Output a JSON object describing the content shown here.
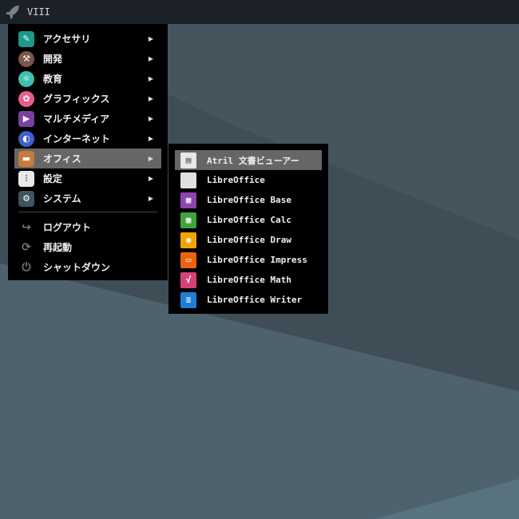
{
  "topbar": {
    "workspace": "VIII",
    "icon": "rocket-icon"
  },
  "main_menu": {
    "items": [
      {
        "label": "アクセサリ",
        "icon": "accessories-icon",
        "color": "#1a9a8a",
        "submenu": true
      },
      {
        "label": "開発",
        "icon": "development-icon",
        "color": "#7a5548",
        "submenu": true
      },
      {
        "label": "教育",
        "icon": "education-icon",
        "color": "#3cc0b0",
        "submenu": true
      },
      {
        "label": "グラフィックス",
        "icon": "graphics-icon",
        "color": "#e85d8a",
        "submenu": true
      },
      {
        "label": "マルチメディア",
        "icon": "multimedia-icon",
        "color": "#7b3fa0",
        "submenu": true
      },
      {
        "label": "インターネット",
        "icon": "internet-icon",
        "color": "#3d5fd0",
        "submenu": true
      },
      {
        "label": "オフィス",
        "icon": "office-icon",
        "color": "#c77a3c",
        "submenu": true,
        "selected": true
      },
      {
        "label": "設定",
        "icon": "settings-icon",
        "color": "#e8e8e8",
        "submenu": true
      },
      {
        "label": "システム",
        "icon": "system-icon",
        "color": "#3c5560",
        "submenu": true
      }
    ],
    "actions": [
      {
        "label": "ログアウト",
        "icon": "logout-icon"
      },
      {
        "label": "再起動",
        "icon": "restart-icon"
      },
      {
        "label": "シャットダウン",
        "icon": "shutdown-icon"
      }
    ]
  },
  "office_menu": {
    "items": [
      {
        "label": "Atril 文書ビューアー",
        "icon": "atril-icon",
        "color": "#e8e8e8",
        "selected": true
      },
      {
        "label": "LibreOffice",
        "icon": "libreoffice-icon",
        "color": "#e0e0e0"
      },
      {
        "label": "LibreOffice Base",
        "icon": "libreoffice-base-icon",
        "color": "#8e44ad"
      },
      {
        "label": "LibreOffice Calc",
        "icon": "libreoffice-calc-icon",
        "color": "#3fa53a"
      },
      {
        "label": "LibreOffice Draw",
        "icon": "libreoffice-draw-icon",
        "color": "#f0a500"
      },
      {
        "label": "LibreOffice Impress",
        "icon": "libreoffice-impress-icon",
        "color": "#e8650f"
      },
      {
        "label": "LibreOffice Math",
        "icon": "libreoffice-math-icon",
        "color": "#d8407a"
      },
      {
        "label": "LibreOffice Writer",
        "icon": "libreoffice-writer-icon",
        "color": "#1e7fd6"
      }
    ]
  }
}
